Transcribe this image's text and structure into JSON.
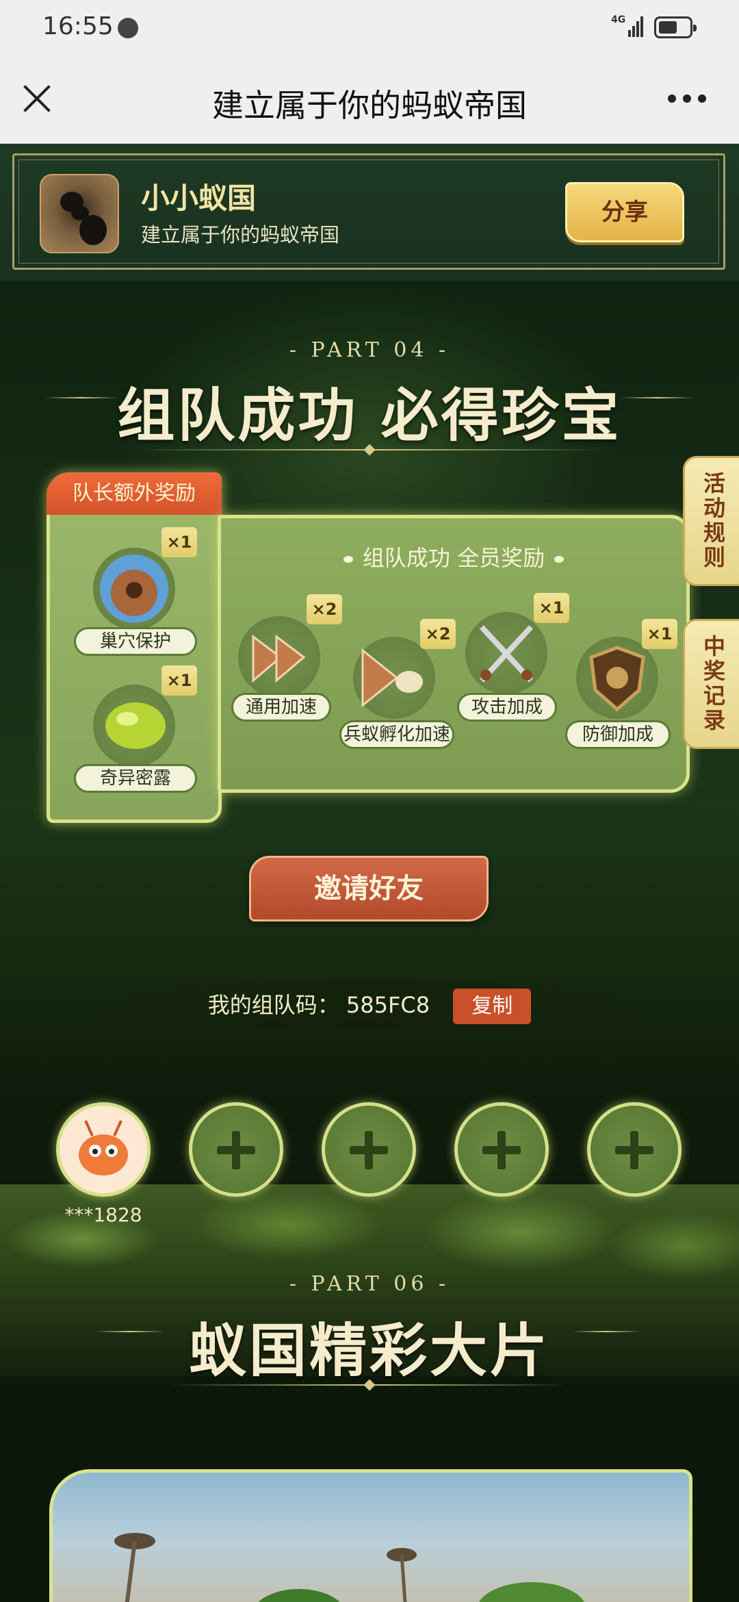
{
  "status_bar": {
    "time": "16:55",
    "network": "4G",
    "battery_level": 0.6
  },
  "title_bar": {
    "title": "建立属于你的蚂蚁帝国"
  },
  "app_banner": {
    "name": "小小蚁国",
    "subtitle": "建立属于你的蚂蚁帝国",
    "share_label": "分享"
  },
  "section1": {
    "part": "- PART 04 -",
    "heading": "组队成功 必得珍宝",
    "leader_tab": "队长额外奖励",
    "leader_rewards": [
      {
        "label": "巢穴保护",
        "count": "×1",
        "icon": "nest-icon"
      },
      {
        "label": "奇异密露",
        "count": "×1",
        "icon": "honeydew-icon"
      }
    ],
    "all_title": "组队成功 全员奖励",
    "all_rewards": [
      {
        "label": "通用加速",
        "count": "×2",
        "icon": "speedup-icon"
      },
      {
        "label": "兵蚁孵化加速",
        "count": "×2",
        "icon": "hatch-speedup-icon"
      },
      {
        "label": "攻击加成",
        "count": "×1",
        "icon": "swords-icon"
      },
      {
        "label": "防御加成",
        "count": "×1",
        "icon": "shield-icon"
      }
    ],
    "side_tabs": {
      "rules": "活动规则",
      "records": "中奖记录"
    },
    "invite_label": "邀请好友",
    "team_code_label": "我的组队码：",
    "team_code": "585FC8",
    "copy_label": "复制",
    "member_name": "***1828"
  },
  "section2": {
    "part": "- PART 06 -",
    "heading": "蚁国精彩大片"
  },
  "colors": {
    "accent_gold": "#e3b347",
    "panel_green": "#8ead5e",
    "invite_red": "#b4492c",
    "glow": "#d9e48a"
  }
}
